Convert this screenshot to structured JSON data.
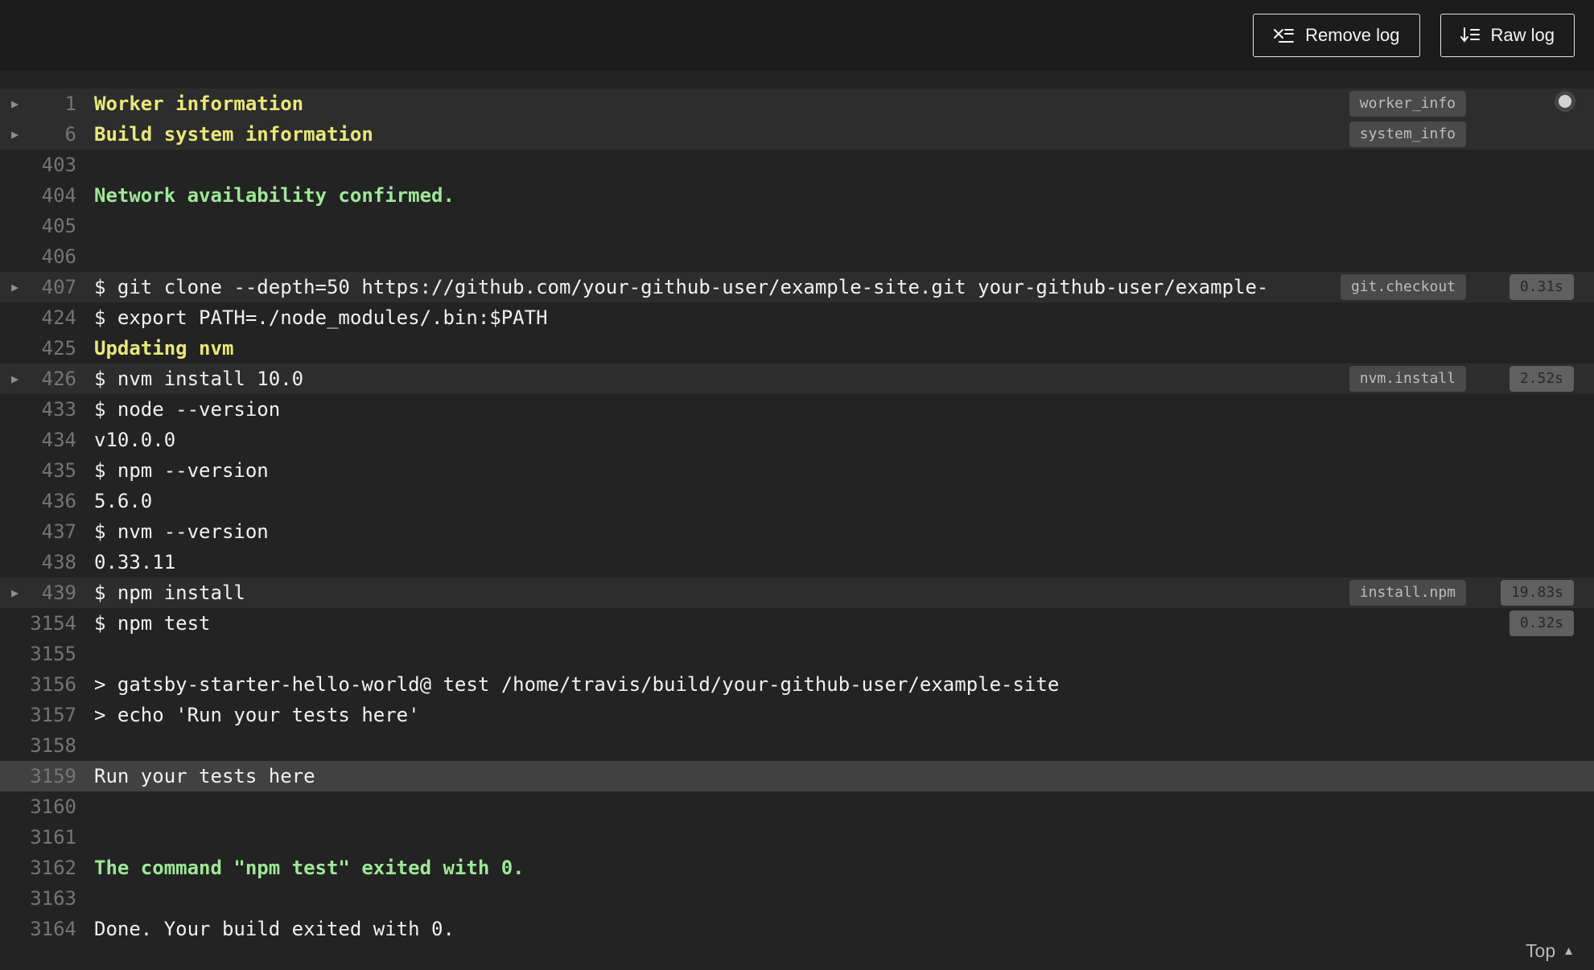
{
  "header": {
    "remove_log": {
      "label": "Remove log",
      "icon": "remove-log-icon"
    },
    "raw_log": {
      "label": "Raw log",
      "icon": "raw-log-icon"
    }
  },
  "footer": {
    "top_label": "Top",
    "icon": "scroll-top-arrow-icon"
  },
  "colors": {
    "background": "#232323",
    "header_background": "#1c1c1c",
    "fold_row_background": "#2d2d2d",
    "highlight_row_background": "#414141",
    "log_text": "#f1f1f1",
    "line_number": "#757575",
    "fold_yellow": "#e9e879",
    "success_green": "#9ee897",
    "name_badge_background": "#4a4a4a",
    "time_badge_background": "#606060"
  },
  "log": {
    "lines": [
      {
        "num": "1",
        "text": "Worker information",
        "style": "fold",
        "arrow": true,
        "badge": "worker_info",
        "row": "fold"
      },
      {
        "num": "6",
        "text": "Build system information",
        "style": "fold",
        "arrow": true,
        "badge": "system_info",
        "row": "fold"
      },
      {
        "num": "403",
        "text": ""
      },
      {
        "num": "404",
        "text": "Network availability confirmed.",
        "style": "green"
      },
      {
        "num": "405",
        "text": ""
      },
      {
        "num": "406",
        "text": ""
      },
      {
        "num": "407",
        "text": "$ git clone --depth=50 https://github.com/your-github-user/example-site.git your-github-user/example-",
        "arrow": true,
        "badge": "git.checkout",
        "time": "0.31s",
        "row": "fold"
      },
      {
        "num": "424",
        "text": "$ export PATH=./node_modules/.bin:$PATH"
      },
      {
        "num": "425",
        "text": "Updating nvm",
        "style": "fold"
      },
      {
        "num": "426",
        "text": "$ nvm install 10.0",
        "arrow": true,
        "badge": "nvm.install",
        "time": "2.52s",
        "row": "fold"
      },
      {
        "num": "433",
        "text": "$ node --version"
      },
      {
        "num": "434",
        "text": "v10.0.0"
      },
      {
        "num": "435",
        "text": "$ npm --version"
      },
      {
        "num": "436",
        "text": "5.6.0"
      },
      {
        "num": "437",
        "text": "$ nvm --version"
      },
      {
        "num": "438",
        "text": "0.33.11"
      },
      {
        "num": "439",
        "text": "$ npm install",
        "arrow": true,
        "badge": "install.npm",
        "time": "19.83s",
        "row": "fold"
      },
      {
        "num": "3154",
        "text": "$ npm test",
        "time": "0.32s"
      },
      {
        "num": "3155",
        "text": ""
      },
      {
        "num": "3156",
        "text": "> gatsby-starter-hello-world@ test /home/travis/build/your-github-user/example-site"
      },
      {
        "num": "3157",
        "text": "> echo 'Run your tests here'"
      },
      {
        "num": "3158",
        "text": ""
      },
      {
        "num": "3159",
        "text": "Run your tests here",
        "row": "highlight"
      },
      {
        "num": "3160",
        "text": ""
      },
      {
        "num": "3161",
        "text": ""
      },
      {
        "num": "3162",
        "text": "The command \"npm test\" exited with 0.",
        "style": "green"
      },
      {
        "num": "3163",
        "text": ""
      },
      {
        "num": "3164",
        "text": "Done. Your build exited with 0."
      }
    ]
  }
}
